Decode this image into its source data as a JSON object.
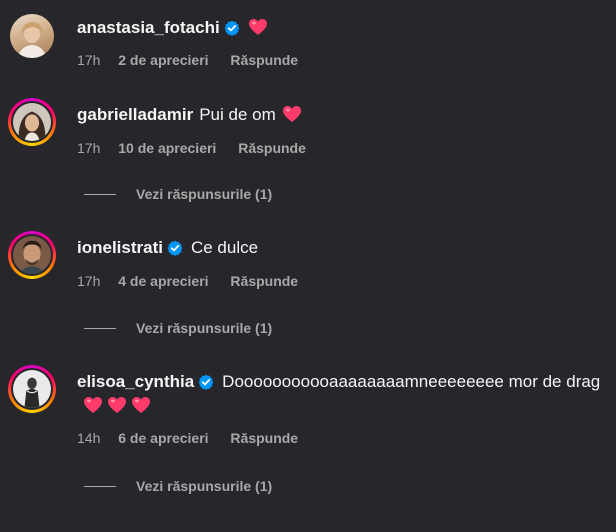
{
  "comments": [
    {
      "username": "anastasia_fotachi",
      "verified": true,
      "text": "",
      "time": "17h",
      "likes": "2 de aprecieri",
      "reply": "Răspunde"
    },
    {
      "username": "gabrielladamir",
      "verified": false,
      "text": "Pui de om",
      "time": "17h",
      "likes": "10 de aprecieri",
      "reply": "Răspunde",
      "view_replies": "Vezi răspunsurile (1)"
    },
    {
      "username": "ionelistrati",
      "verified": true,
      "text": "Ce dulce",
      "time": "17h",
      "likes": "4 de aprecieri",
      "reply": "Răspunde",
      "view_replies": "Vezi răspunsurile (1)"
    },
    {
      "username": "elisoa_cynthia",
      "verified": true,
      "text": "Dooooooooooaaaaaaaamneeeeeeee mor de drag",
      "time": "14h",
      "likes": "6 de aprecieri",
      "reply": "Răspunde",
      "view_replies": "Vezi răspunsurile (1)"
    }
  ],
  "colors": {
    "background": "#26262b",
    "text": "#f5f5f5",
    "muted": "#a8a8a8",
    "verified": "#0095f6",
    "heart": "#ff3b6b"
  },
  "icons": {
    "verified": "verified-badge-icon",
    "heart": "red-heart-emoji-icon"
  }
}
